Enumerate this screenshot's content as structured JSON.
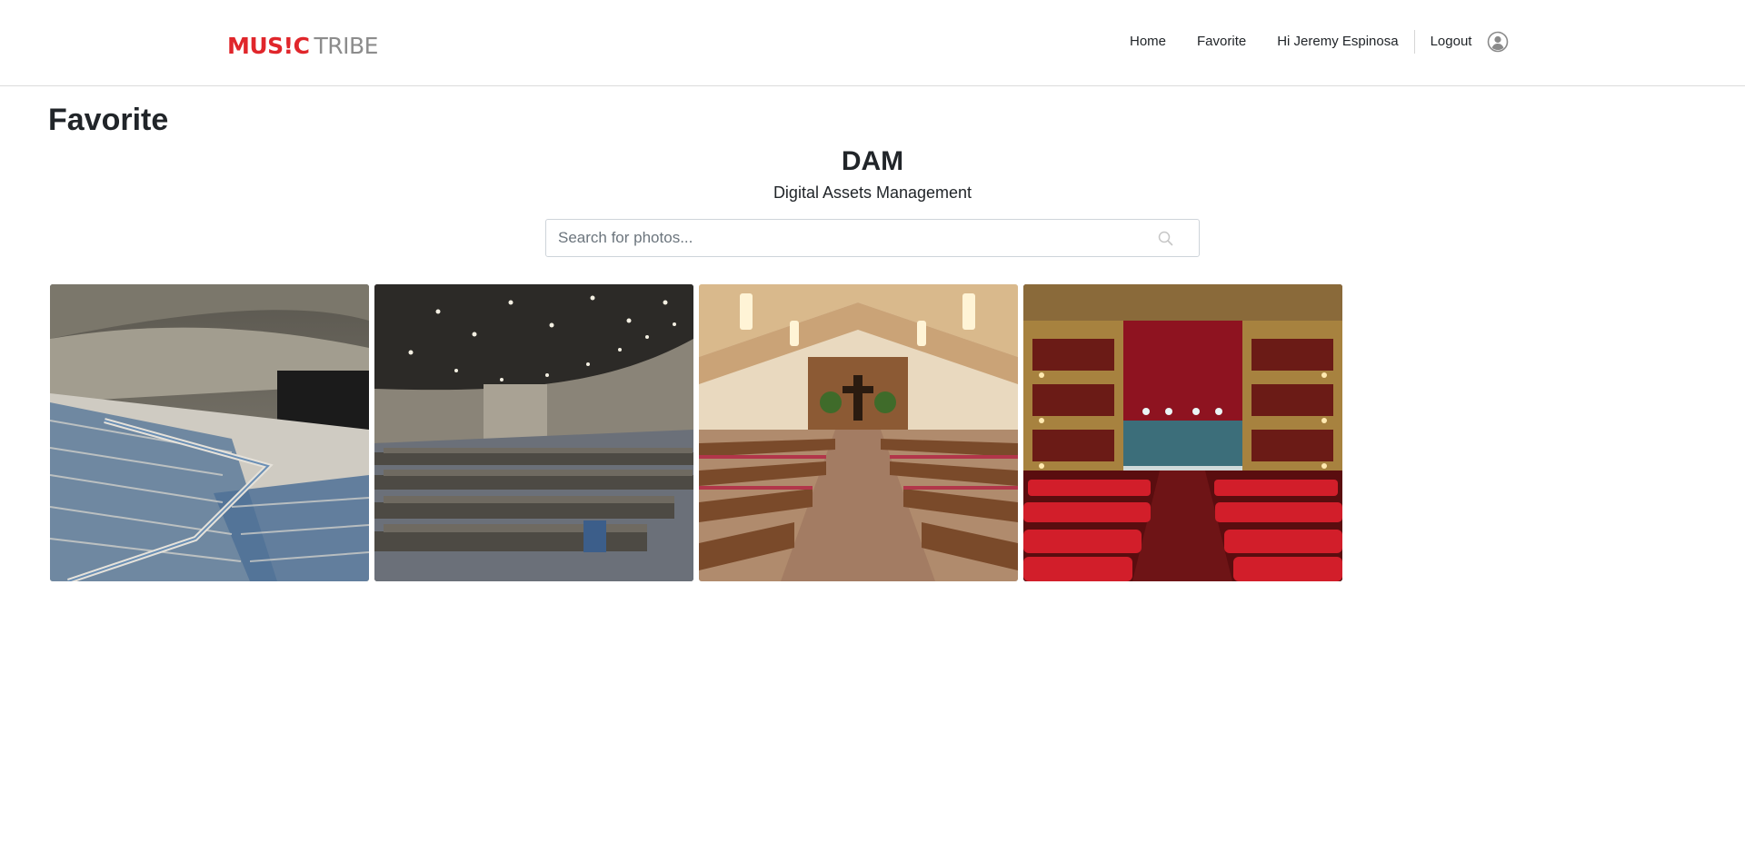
{
  "header": {
    "logo": {
      "word1": "MUS!C",
      "word2": "TRIBE"
    },
    "nav": {
      "home": "Home",
      "favorite": "Favorite",
      "greeting": "Hi Jeremy Espinosa",
      "logout": "Logout"
    },
    "user_icon": "user-circle-icon"
  },
  "page": {
    "title": "Favorite"
  },
  "hero": {
    "title": "DAM",
    "subtitle": "Digital Assets Management"
  },
  "search": {
    "placeholder": "Search for photos...",
    "value": "",
    "icon": "search-icon"
  },
  "photos": [
    {
      "scene": "auditorium-blue-seats"
    },
    {
      "scene": "auditorium-chairs"
    },
    {
      "scene": "church-pews"
    },
    {
      "scene": "theater-red-seats"
    }
  ],
  "colors": {
    "brand_red": "#e0262b",
    "brand_gray": "#8c8c8c",
    "text": "#212529",
    "border": "#dcdcdc"
  }
}
